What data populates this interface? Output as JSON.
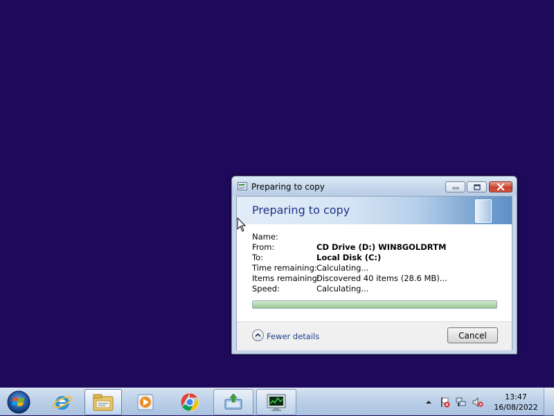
{
  "window": {
    "title": "Preparing to copy",
    "heading": "Preparing to copy",
    "minimize_icon": "minimize-icon",
    "maximize_icon": "maximize-icon",
    "close_icon": "close-icon"
  },
  "details": {
    "name_label": "Name:",
    "name_value": "",
    "from_label": "From:",
    "from_value": "CD Drive (D:) WIN8GOLDRTM",
    "to_label": "To:",
    "to_value": "Local Disk (C:)",
    "time_label": "Time remaining:",
    "time_value": "Calculating...",
    "items_label": "Items remaining:",
    "items_value": "Discovered 40 items (28.6 MB)...",
    "speed_label": "Speed:",
    "speed_value": "Calculating..."
  },
  "progress": {
    "fraction": 1.0
  },
  "footer": {
    "details_toggle_label": "Fewer details",
    "details_toggle_icon": "chevron-up-icon",
    "cancel_label": "Cancel"
  },
  "taskbar": {
    "items": [
      {
        "icon": "windows-start-icon"
      },
      {
        "icon": "internet-explorer-icon"
      },
      {
        "icon": "file-explorer-icon"
      },
      {
        "icon": "media-player-icon"
      },
      {
        "icon": "chrome-icon"
      },
      {
        "icon": "file-copy-icon"
      },
      {
        "icon": "task-manager-icon"
      }
    ],
    "tray": {
      "icons": [
        "show-hidden-icons-arrow",
        "action-center-flag-icon",
        "network-icon",
        "volume-muted-icon"
      ],
      "time": "13:47",
      "date": "16/08/2022"
    }
  },
  "colors": {
    "desktop": "#1e0a5a",
    "heading": "#1e3287",
    "link": "#1b3f8f"
  }
}
